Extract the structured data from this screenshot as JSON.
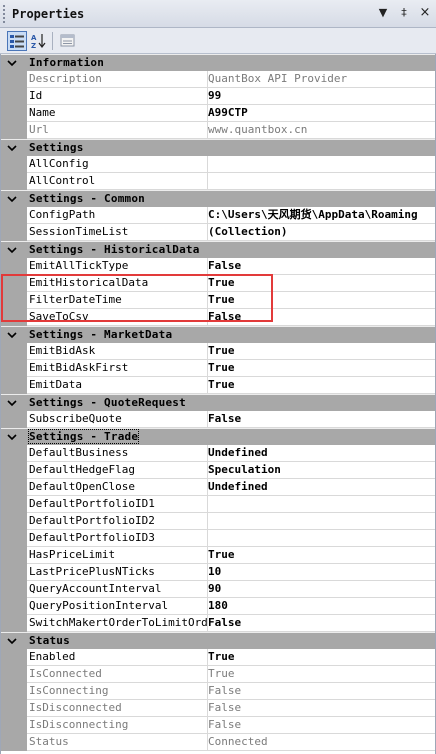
{
  "window": {
    "title": "Properties",
    "dropdown_glyph": "▼",
    "pin_glyph": "‡",
    "close_glyph": "×"
  },
  "toolbar": {
    "categorized": "categorized-icon",
    "alphabetical": "alphabetical-sort-icon",
    "property_pages": "property-pages-icon"
  },
  "categories": [
    {
      "label": "Information",
      "rows": [
        {
          "name": "Description",
          "value": "QuantBox API Provider",
          "readonly": true,
          "bold": false
        },
        {
          "name": "Id",
          "value": "99",
          "readonly": false,
          "bold": true
        },
        {
          "name": "Name",
          "value": "A99CTP",
          "readonly": false,
          "bold": true
        },
        {
          "name": "Url",
          "value": "www.quantbox.cn",
          "readonly": true,
          "bold": false
        }
      ]
    },
    {
      "label": "Settings",
      "rows": [
        {
          "name": "AllConfig",
          "value": "",
          "readonly": false,
          "bold": false
        },
        {
          "name": "AllControl",
          "value": "",
          "readonly": false,
          "bold": false
        }
      ]
    },
    {
      "label": "Settings - Common",
      "rows": [
        {
          "name": "ConfigPath",
          "value": "C:\\Users\\天风期货\\AppData\\Roaming",
          "readonly": false,
          "bold": true
        },
        {
          "name": "SessionTimeList",
          "value": "(Collection)",
          "readonly": false,
          "bold": true
        }
      ]
    },
    {
      "label": "Settings - HistoricalData",
      "rows": [
        {
          "name": "EmitAllTickType",
          "value": "False",
          "readonly": false,
          "bold": true
        },
        {
          "name": "EmitHistoricalData",
          "value": "True",
          "readonly": false,
          "bold": true
        },
        {
          "name": "FilterDateTime",
          "value": "True",
          "readonly": false,
          "bold": true
        },
        {
          "name": "SaveToCsv",
          "value": "False",
          "readonly": false,
          "bold": true
        }
      ]
    },
    {
      "label": "Settings - MarketData",
      "rows": [
        {
          "name": "EmitBidAsk",
          "value": "True",
          "readonly": false,
          "bold": true
        },
        {
          "name": "EmitBidAskFirst",
          "value": "True",
          "readonly": false,
          "bold": true
        },
        {
          "name": "EmitData",
          "value": "True",
          "readonly": false,
          "bold": true
        }
      ]
    },
    {
      "label": "Settings - QuoteRequest",
      "rows": [
        {
          "name": "SubscribeQuote",
          "value": "False",
          "readonly": false,
          "bold": true
        }
      ]
    },
    {
      "label": "Settings - Trade",
      "focused": true,
      "rows": [
        {
          "name": "DefaultBusiness",
          "value": "Undefined",
          "readonly": false,
          "bold": true
        },
        {
          "name": "DefaultHedgeFlag",
          "value": "Speculation",
          "readonly": false,
          "bold": true
        },
        {
          "name": "DefaultOpenClose",
          "value": "Undefined",
          "readonly": false,
          "bold": true
        },
        {
          "name": "DefaultPortfolioID1",
          "value": "",
          "readonly": false,
          "bold": false
        },
        {
          "name": "DefaultPortfolioID2",
          "value": "",
          "readonly": false,
          "bold": false
        },
        {
          "name": "DefaultPortfolioID3",
          "value": "",
          "readonly": false,
          "bold": false
        },
        {
          "name": "HasPriceLimit",
          "value": "True",
          "readonly": false,
          "bold": true
        },
        {
          "name": "LastPricePlusNTicks",
          "value": "10",
          "readonly": false,
          "bold": true
        },
        {
          "name": "QueryAccountInterval",
          "value": "90",
          "readonly": false,
          "bold": true
        },
        {
          "name": "QueryPositionInterval",
          "value": "180",
          "readonly": false,
          "bold": true
        },
        {
          "name": "SwitchMakertOrderToLimitOrder",
          "value": "False",
          "readonly": false,
          "bold": true
        }
      ]
    },
    {
      "label": "Status",
      "rows": [
        {
          "name": "Enabled",
          "value": "True",
          "readonly": false,
          "bold": true
        },
        {
          "name": "IsConnected",
          "value": "True",
          "readonly": true,
          "bold": false
        },
        {
          "name": "IsConnecting",
          "value": "False",
          "readonly": true,
          "bold": false
        },
        {
          "name": "IsDisconnected",
          "value": "False",
          "readonly": true,
          "bold": false
        },
        {
          "name": "IsDisconnecting",
          "value": "False",
          "readonly": true,
          "bold": false
        },
        {
          "name": "Status",
          "value": "Connected",
          "readonly": true,
          "bold": false
        }
      ]
    }
  ],
  "colors": {
    "category_bg": "#a8a8a8",
    "readonly_text": "#7b7b7b",
    "highlight_border": "#e23a3a"
  }
}
